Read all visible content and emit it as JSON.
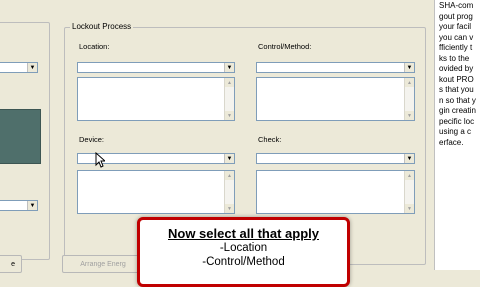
{
  "group": {
    "title": "Lockout Process"
  },
  "fields": {
    "location_label": "Location:",
    "control_method_label": "Control/Method:",
    "device_label": "Device:",
    "check_label": "Check:"
  },
  "icons": {
    "dropdown": "▼",
    "scroll_up": "▲",
    "scroll_down": "▼"
  },
  "buttons": {
    "left_partial": "e",
    "arrange_energy": "Arrange Energ"
  },
  "sidebar_lines": [
    "SHA-com",
    "gout prog",
    "your facil",
    "you can v",
    "fficiently t",
    "ks to the",
    "ovided by",
    "kout PRO",
    "s that you",
    "n so that y",
    "gin creatin",
    "pecific loc",
    "using a c",
    "erface."
  ],
  "callout": {
    "heading": "Now select all that apply",
    "items": [
      "-Location",
      "-Control/Method"
    ]
  },
  "colors": {
    "callout_border": "#c00000",
    "dark_panel": "#4f6f6b",
    "window_bg": "#ece9d8"
  }
}
